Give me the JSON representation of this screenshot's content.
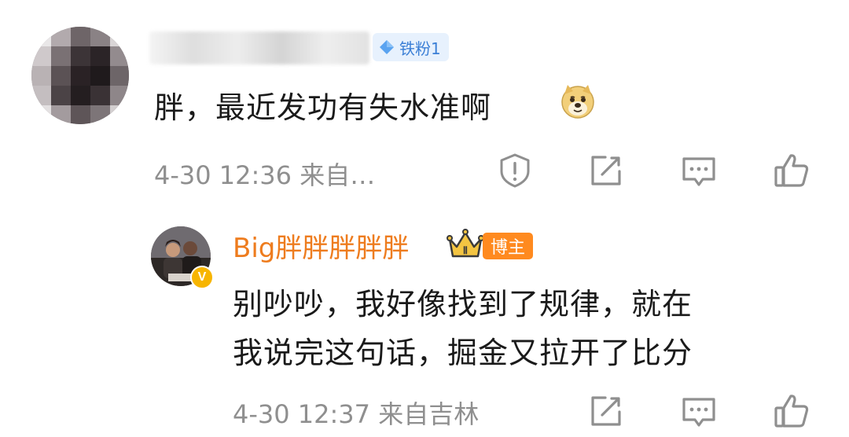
{
  "comment": {
    "author_badge": "铁粉1",
    "text": "胖，最近发功有失水准啊",
    "emoji": "doge-emoji",
    "meta": "4-30 12:36 来自…",
    "actions": [
      "report-icon",
      "share-icon",
      "reply-icon",
      "like-icon"
    ]
  },
  "reply": {
    "author": "Big胖胖胖胖胖",
    "crown_level": "Ⅱ",
    "badge": "博主",
    "verified": "V",
    "lines": [
      "别吵吵，我好像找到了规律，就在",
      "我说完这句话，掘金又拉开了比分"
    ],
    "meta": "4-30 12:37 来自吉林",
    "actions": [
      "share-icon",
      "reply-icon",
      "like-icon"
    ]
  },
  "colors": {
    "accent": "#ee7c1e",
    "badge_orange": "#ff8a1f",
    "fan_badge_text": "#3b7fd6",
    "meta_grey": "#8f8f8f"
  }
}
